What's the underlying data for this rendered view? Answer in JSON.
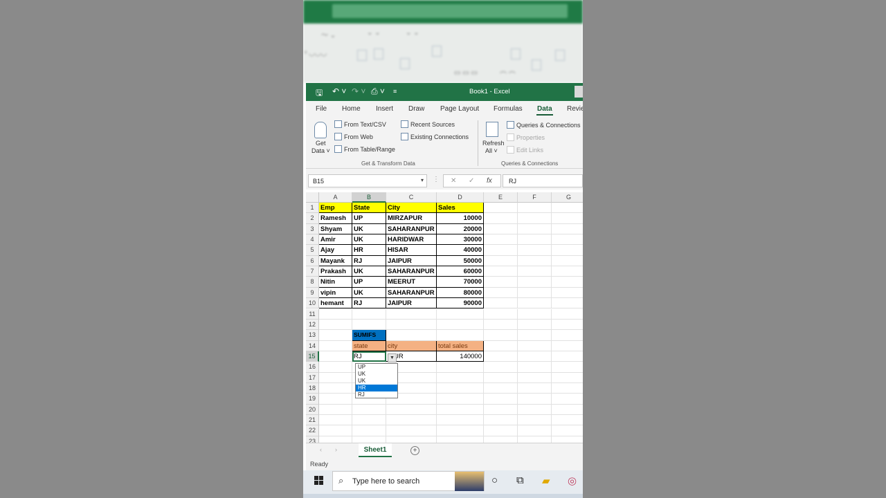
{
  "window": {
    "title": "Book1  -  Excel"
  },
  "menu": {
    "tabs": [
      "File",
      "Home",
      "Insert",
      "Draw",
      "Page Layout",
      "Formulas",
      "Data",
      "Revie"
    ],
    "active": "Data"
  },
  "ribbon": {
    "get_data": [
      "Get",
      "Data ˅"
    ],
    "from_text_csv": "From Text/CSV",
    "from_web": "From Web",
    "from_table_range": "From Table/Range",
    "recent_sources": "Recent Sources",
    "existing_connections": "Existing Connections",
    "group1": "Get & Transform Data",
    "refresh_all": [
      "Refresh",
      "All ˅"
    ],
    "queries_connections": "Queries & Connections",
    "properties": "Properties",
    "edit_links": "Edit Links",
    "group2": "Queries & Connections"
  },
  "formula_bar": {
    "name_box": "B15",
    "cancel": "✕",
    "enter": "✓",
    "fx": "fx",
    "value": "RJ"
  },
  "columns": [
    "A",
    "B",
    "C",
    "D",
    "E",
    "F",
    "G"
  ],
  "rows": [
    "1",
    "2",
    "3",
    "4",
    "5",
    "6",
    "7",
    "8",
    "9",
    "10",
    "11",
    "12",
    "13",
    "14",
    "15",
    "16",
    "17",
    "18",
    "19",
    "20",
    "21",
    "22",
    "23"
  ],
  "table": {
    "headers": [
      "Emp",
      "State",
      "City",
      "Sales"
    ],
    "data": [
      [
        "Ramesh",
        "UP",
        "MIRZAPUR",
        "10000"
      ],
      [
        "Shyam",
        "UK",
        "SAHARANPUR",
        "20000"
      ],
      [
        "Amir",
        "UK",
        "HARIDWAR",
        "30000"
      ],
      [
        "Ajay",
        "HR",
        "HISAR",
        "40000"
      ],
      [
        "Mayank",
        "RJ",
        "JAIPUR",
        "50000"
      ],
      [
        "Prakash",
        "UK",
        "SAHARANPUR",
        "60000"
      ],
      [
        "Nitin",
        "UP",
        "MEERUT",
        "70000"
      ],
      [
        "vipin",
        "UK",
        "SAHARANPUR",
        "80000"
      ],
      [
        "hemant",
        "RJ",
        "JAIPUR",
        "90000"
      ]
    ]
  },
  "sumifs": {
    "title": "SUMIFS",
    "headers": [
      "state",
      "city",
      "total sales"
    ],
    "state": "RJ",
    "city": "IPUR",
    "total": "140000"
  },
  "dropdown": {
    "options": [
      "UP",
      "UK",
      "UK",
      "HR",
      "RJ"
    ],
    "highlighted": "HR"
  },
  "sheet_tab": "Sheet1",
  "status": "Ready",
  "taskbar": {
    "search_placeholder": "Type here to search"
  }
}
